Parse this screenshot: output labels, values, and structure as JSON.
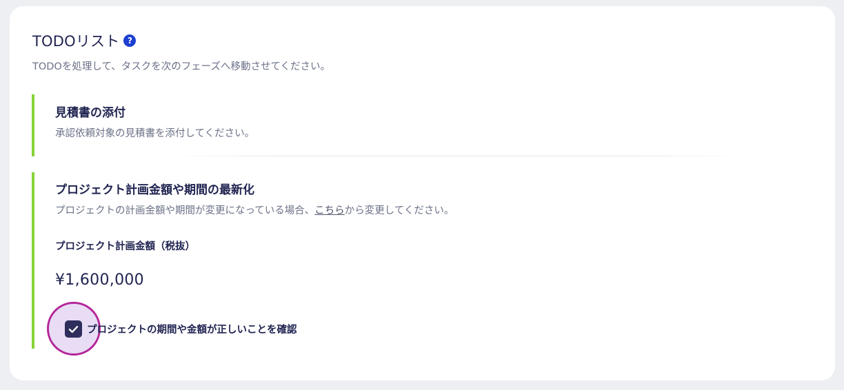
{
  "todo": {
    "title": "TODOリスト",
    "help_icon": "?",
    "subtitle": "TODOを処理して、タスクを次のフェーズへ移動させてください。"
  },
  "tasks": [
    {
      "title": "見積書の添付",
      "description": "承認依頼対象の見積書を添付してください。"
    },
    {
      "title": "プロジェクト計画金額や期間の最新化",
      "description_prefix": "プロジェクトの計画金額や期間が変更になっている場合、",
      "description_link": "こちら",
      "description_suffix": "から変更してください。",
      "field_label": "プロジェクト計画金額（税抜）",
      "amount": "¥1,600,000",
      "confirm_label": "プロジェクトの期間や金額が正しいことを確認",
      "confirm_checked": true
    }
  ],
  "colors": {
    "accent_border": "#86d33a",
    "help_icon_bg": "#1d3fd1",
    "checkbox_bg": "#2e2e5c",
    "highlight_ring": "#b4279a",
    "highlight_fill": "#e9ddf6"
  },
  "icons": {
    "help": "question-circle-icon",
    "check": "checkmark-icon"
  }
}
